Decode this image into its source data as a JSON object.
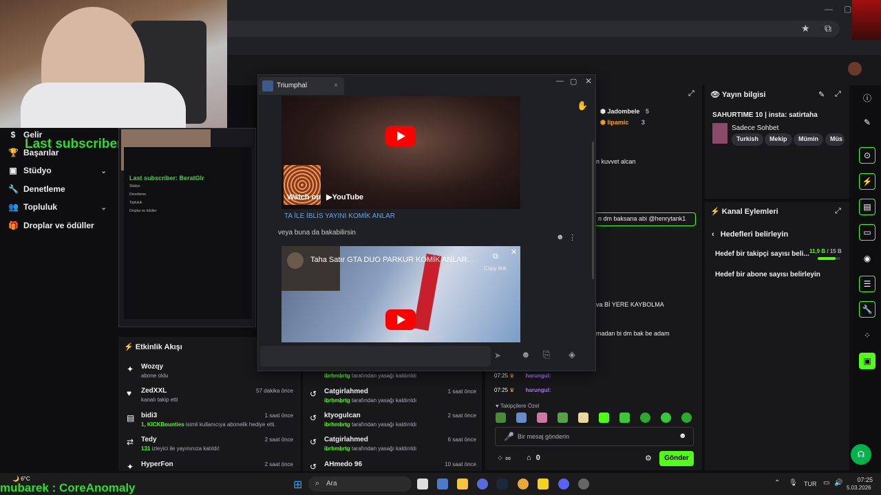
{
  "browser": {
    "star_icon": "star-icon",
    "ext_icon": "puzzle-icon"
  },
  "overlay": {
    "last_subscriber": "Last subscriber: BeratGlr",
    "mini_last_subscriber": "Last subscriber: BeratGlr",
    "alert_user": "mubarek : CoreAnomaly"
  },
  "leftnav": {
    "items": [
      {
        "label": "Gelir",
        "icon": "dollar-icon"
      },
      {
        "label": "Başarılar",
        "icon": "trophy-icon"
      },
      {
        "label": "Stüdyo",
        "icon": "studio-icon"
      },
      {
        "label": "Denetleme",
        "icon": "wrench-icon"
      },
      {
        "label": "Topluluk",
        "icon": "community-icon"
      },
      {
        "label": "Droplar ve ödüller",
        "icon": "gift-icon"
      }
    ]
  },
  "mini_nav": [
    "Gelir",
    "Başarılar",
    "Stüdyo",
    "Denetleme",
    "Topluluk",
    "Droplar ve ödüller"
  ],
  "activity": {
    "title": "Etkinlik Akışı",
    "rows": [
      {
        "name": "Wozqy",
        "sub": "abone oldu",
        "time": ""
      },
      {
        "name": "ZedXXL",
        "sub": "kanalı takip etti",
        "time": "57 dakika önce"
      },
      {
        "name": "bidi3",
        "sub_b": "1, KICKBounties",
        "sub": " isimli kullanıcıya abonelik hediye etti.",
        "time": "1 saat önce"
      },
      {
        "name": "Tedy",
        "sub_b": "131",
        "sub": " izleyici ile yayınınıza katıldı!",
        "time": "2 saat önce"
      },
      {
        "name": "HyperFon",
        "sub": "",
        "time": "2 saat önce"
      }
    ]
  },
  "modlog": {
    "rows": [
      {
        "name": "",
        "sub_b": "ibrhmbrtg",
        "sub": " tarafından yasağı kaldırıldı",
        "time": ""
      },
      {
        "name": "Catgirlahmed",
        "sub_b": "ibrhmbrtg",
        "sub": " tarafından yasağı kaldırıldı",
        "time": "1 saat önce"
      },
      {
        "name": "ktyogulcan",
        "sub_b": "ibrhmbrtg",
        "sub": " tarafından yasağı kaldırıldı",
        "time": "2 saat önce"
      },
      {
        "name": "Catgirlahmed",
        "sub_b": "ibrhmbrtg",
        "sub": " tarafından yasağı kaldırıldı",
        "time": "6 saat önce"
      },
      {
        "name": "AHmedo 96",
        "sub": "",
        "time": "10 saat önce"
      }
    ]
  },
  "chat": {
    "leaderboard": [
      {
        "name": "Jadombele",
        "count": "5"
      },
      {
        "name": "lipamic",
        "count": "3"
      }
    ],
    "lines": [
      "n kuvvet alcan",
      "n dm baksana abi @henrytank1",
      "va Bİ YERE KAYBOLMA",
      "madan bi dm bak be adam"
    ],
    "bottom_rows": [
      {
        "time": "07:25",
        "user": "harungul:"
      },
      {
        "time": "07:25",
        "user": "harungul:"
      }
    ],
    "emote_label": "Takipçilere Özel",
    "input_placeholder": "Bir mesaj gönderin",
    "infinity": "∞",
    "count": "0",
    "send_label": "Gönder"
  },
  "stream_info": {
    "title": "Yayın bilgisi",
    "stream_title": "SAHURTIME 10 | insta: satirtaha",
    "category": "Sadece Sohbet",
    "tags": [
      "Turkish",
      "Mekip",
      "Mümin",
      "Müs"
    ]
  },
  "channel_actions": {
    "title": "Kanal Eylemleri",
    "back_label": "Hedefleri belirleyin",
    "goal1": "Hedef bir takipçi sayısı beli...",
    "goal1_value": "11,9 B",
    "goal1_total": "/ 15 B",
    "goal1_progress": 0.79,
    "goal2": "Hedef bir abone sayısı belirleyin"
  },
  "triumphal": {
    "tab": "Triumphal",
    "video1_caption": "TA İLE İBLİS YAYINI KOMİK ANLAR",
    "watch_on": "Watch on",
    "youtube": "YouTube",
    "message": "veya buna da bakabilirsin",
    "video2_title": "Taha Satır GTA DUO PARKUR KOMİK ANLAR...",
    "copy_link": "Copy link",
    "scroll_bottom": "Scroll to bottom"
  },
  "taskbar": {
    "weather_temp": "6°C",
    "search": "Ara",
    "lang": "TUR",
    "time": "07:25",
    "date": "5.03.2026"
  }
}
